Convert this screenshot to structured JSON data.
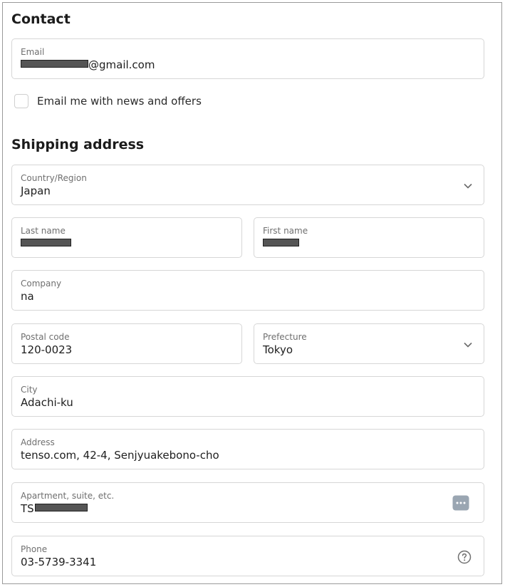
{
  "contact": {
    "title": "Contact",
    "email": {
      "label": "Email",
      "value": "@gmail.com"
    },
    "newsletter_label": "Email me with news and offers",
    "newsletter_checked": false
  },
  "shipping": {
    "title": "Shipping address",
    "country": {
      "label": "Country/Region",
      "value": "Japan"
    },
    "last_name": {
      "label": "Last name",
      "value": ""
    },
    "first_name": {
      "label": "First name",
      "value": ""
    },
    "company": {
      "label": "Company",
      "value": "na"
    },
    "postal_code": {
      "label": "Postal code",
      "value": "120-0023"
    },
    "prefecture": {
      "label": "Prefecture",
      "value": "Tokyo"
    },
    "city": {
      "label": "City",
      "value": "Adachi-ku"
    },
    "address": {
      "label": "Address",
      "value": "tenso.com, 42-4, Senjyuakebono-cho"
    },
    "apartment": {
      "label": "Apartment, suite, etc.",
      "value": "TS"
    },
    "phone": {
      "label": "Phone",
      "value": "03-5739-3341"
    }
  },
  "icons": {
    "dropdown": "chevron-down-icon",
    "autofill": "autofill-dots-icon",
    "help": "question-circle-icon"
  }
}
